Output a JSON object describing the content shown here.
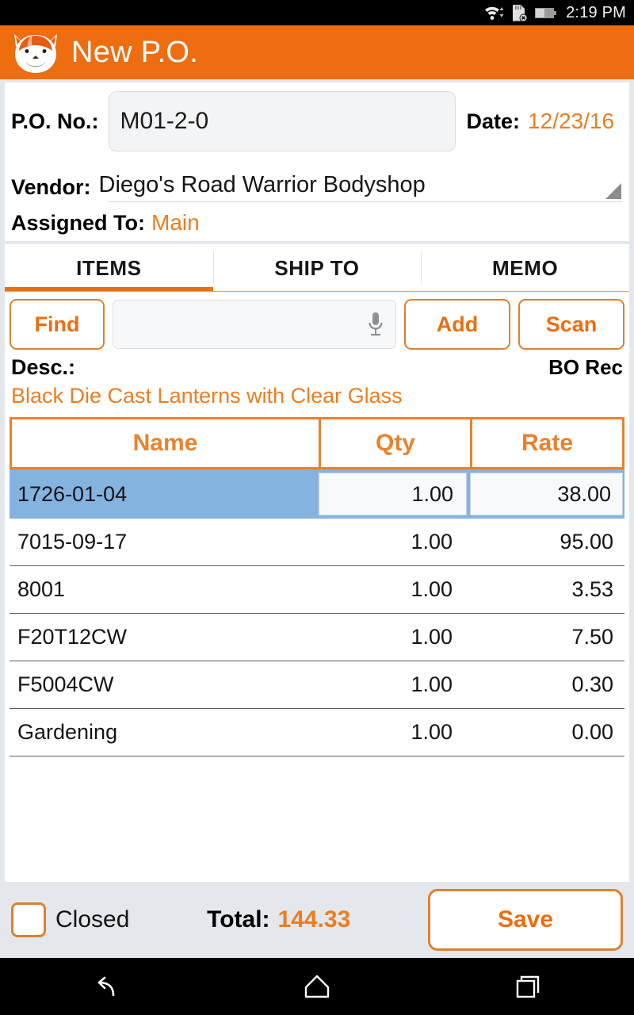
{
  "status_bar": {
    "time": "2:19 PM",
    "icons": [
      "wifi-icon",
      "sd-card-error-icon",
      "battery-icon"
    ]
  },
  "app_bar": {
    "title": "New P.O.",
    "logo": "fox-logo-icon",
    "background_color": "#ed6d10"
  },
  "form": {
    "po_label": "P.O. No.:",
    "po_value": "M01-2-0",
    "po_placeholder": "",
    "date_label": "Date:",
    "date_value": "12/23/16",
    "vendor_label": "Vendor:",
    "vendor_value": "Diego's Road Warrior Bodyshop",
    "assigned_label": "Assigned To:",
    "assigned_value": "Main"
  },
  "tabs": [
    {
      "label": "ITEMS",
      "active": true
    },
    {
      "label": "SHIP TO",
      "active": false
    },
    {
      "label": "MEMO",
      "active": false
    }
  ],
  "toolbar": {
    "find_label": "Find",
    "search_value": "",
    "search_placeholder": "",
    "mic_icon": "microphone-icon",
    "add_label": "Add",
    "scan_label": "Scan"
  },
  "description": {
    "label": "Desc.:",
    "bo_rec_label": "BO Rec",
    "value": "Black Die Cast Lanterns with Clear Glass"
  },
  "table": {
    "columns": [
      "Name",
      "Qty",
      "Rate"
    ],
    "rows": [
      {
        "name": "1726-01-04",
        "qty": "1.00",
        "rate": "38.00",
        "selected": true
      },
      {
        "name": "7015-09-17",
        "qty": "1.00",
        "rate": "95.00",
        "selected": false
      },
      {
        "name": "8001",
        "qty": "1.00",
        "rate": "3.53",
        "selected": false
      },
      {
        "name": "F20T12CW",
        "qty": "1.00",
        "rate": "7.50",
        "selected": false
      },
      {
        "name": "F5004CW",
        "qty": "1.00",
        "rate": "0.30",
        "selected": false
      },
      {
        "name": "Gardening",
        "qty": "1.00",
        "rate": "0.00",
        "selected": false
      }
    ]
  },
  "footer": {
    "closed_label": "Closed",
    "closed_checked": false,
    "total_label": "Total:",
    "total_value": "144.33",
    "save_label": "Save"
  },
  "nav_bar": {
    "back": "back-icon",
    "home": "home-icon",
    "recents": "recents-icon"
  },
  "colors": {
    "accent": "#ed6d10",
    "accent_text": "#ed7d21",
    "selected_row": "#85b3e0",
    "table_border": "#e8822e"
  }
}
